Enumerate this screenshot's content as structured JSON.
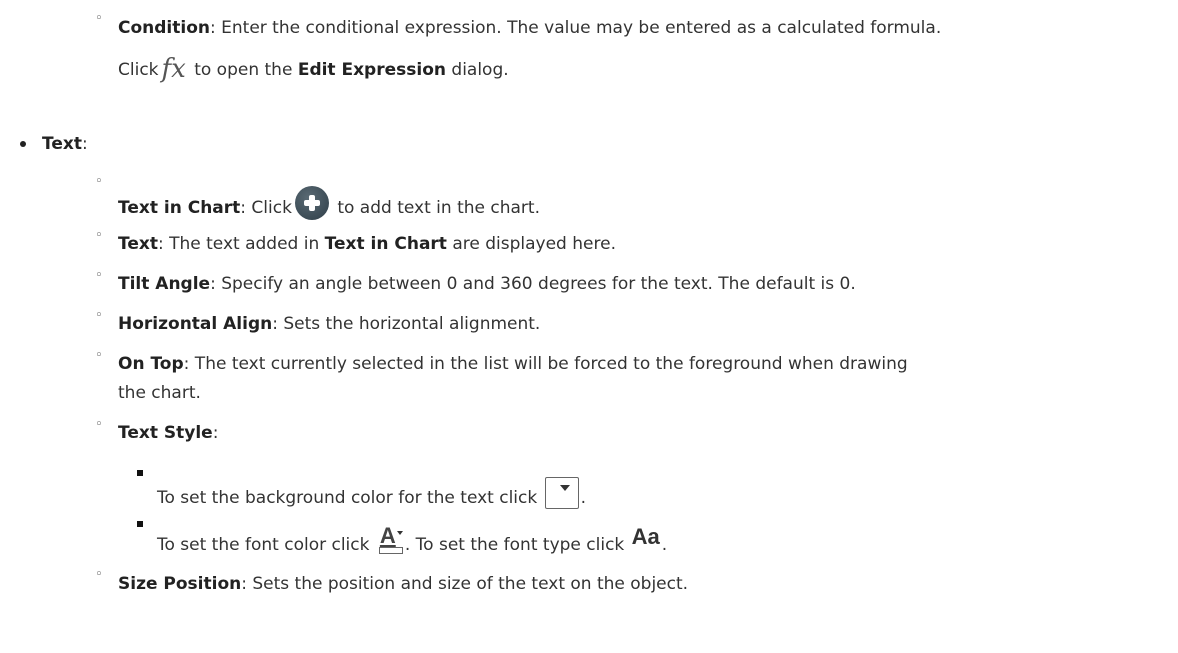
{
  "condition": {
    "term": "Condition",
    "desc": ": Enter the conditional expression. The value may be entered as a calculated formula.",
    "click": "Click",
    "fx_icon": "fx-icon",
    "to_open": " to open the ",
    "dialog_name": "Edit Expression",
    "dialog_suffix": " dialog."
  },
  "text_section": {
    "term": "Text",
    "colon": ":",
    "items": [
      {
        "term": "Text in Chart",
        "pre": ": Click",
        "icon": "add-circle-icon",
        "post": " to add text in the chart."
      },
      {
        "term": "Text",
        "pre": ": The text added in ",
        "ref": "Text in Chart",
        "post": " are displayed here."
      },
      {
        "term": "Tilt Angle",
        "desc": ": Specify an angle between 0 and 360 degrees for the text. The default is 0."
      },
      {
        "term": "Horizontal Align",
        "desc": ": Sets the horizontal alignment."
      },
      {
        "term": "On Top",
        "desc": ": The text currently selected in the list will be forced to the foreground when drawing",
        "desc2": "the chart."
      },
      {
        "term": "Text Style",
        "desc": ":"
      },
      {
        "term": "Size Position",
        "desc": ": Sets the position and size of the text on the object."
      }
    ],
    "style_items": [
      {
        "text": "To set the background color for the text click",
        "icon": "color-dropdown-icon",
        "post": "."
      },
      {
        "text": "To set the font color click",
        "icon": "font-color-icon",
        "mid": ". To set the font type click",
        "icon2": "font-type-icon",
        "post": "."
      }
    ]
  },
  "bullets": {
    "circle": "◦"
  }
}
